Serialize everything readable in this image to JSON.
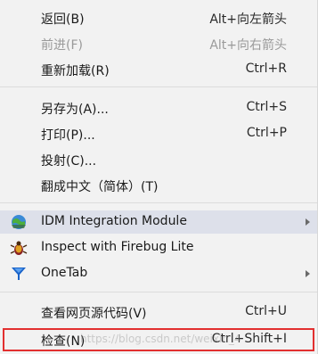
{
  "menu": {
    "items": [
      {
        "label": "返回(B)",
        "shortcut": "Alt+向左箭头"
      },
      {
        "label": "前进(F)",
        "shortcut": "Alt+向右箭头"
      },
      {
        "label": "重新加载(R)",
        "shortcut": "Ctrl+R"
      },
      {
        "label": "另存为(A)...",
        "shortcut": "Ctrl+S"
      },
      {
        "label": "打印(P)...",
        "shortcut": "Ctrl+P"
      },
      {
        "label": "投射(C)...",
        "shortcut": ""
      },
      {
        "label": "翻成中文（简体）(T)",
        "shortcut": ""
      },
      {
        "label": "IDM Integration Module",
        "icon": "idm-globe-icon"
      },
      {
        "label": "Inspect with Firebug Lite",
        "icon": "firebug-icon"
      },
      {
        "label": "OneTab",
        "icon": "onetab-funnel-icon"
      },
      {
        "label": "查看网页源代码(V)",
        "shortcut": "Ctrl+U"
      },
      {
        "label": "检查(N)",
        "shortcut": "Ctrl+Shift+I"
      }
    ]
  },
  "watermark": "https://blog.csdn.net/weixin_4",
  "colors": {
    "menu_bg": "#f2f2f2",
    "highlight": "#dde0ea",
    "disabled_text": "#9a9a9a",
    "annotation_box": "#e23030"
  }
}
